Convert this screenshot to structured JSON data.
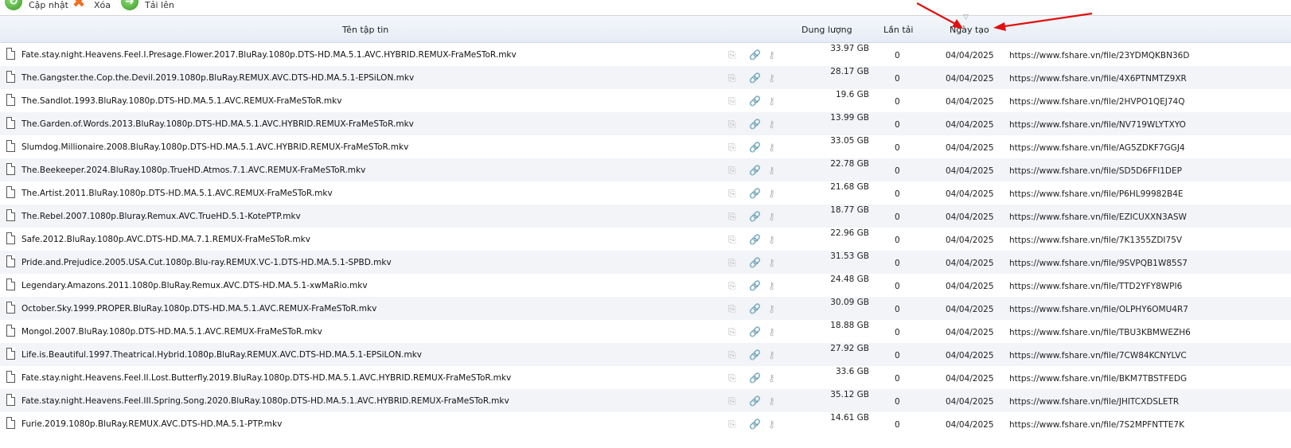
{
  "toolbar": {
    "update_label": "Cập nhật",
    "delete_label": "Xóa",
    "transfer_label": "Tải lên"
  },
  "columns": {
    "name": "Tên tập tin",
    "size": "Dung lượng",
    "downloads": "Lần tải",
    "created": "Ngày tạo"
  },
  "colors": {
    "arrow": "#e01010",
    "header_bg": "#e9eef7",
    "row_alt": "#f2f4f8"
  },
  "files": [
    {
      "name": "Fate.stay.night.Heavens.Feel.I.Presage.Flower.2017.BluRay.1080p.DTS-HD.MA.5.1.AVC.HYBRID.REMUX-FraMeSToR.mkv",
      "size": "33.97 GB",
      "downloads": "0",
      "date": "04/04/2025",
      "link": "https://www.fshare.vn/file/23YDMQKBN36D"
    },
    {
      "name": "The.Gangster.the.Cop.the.Devil.2019.1080p.BluRay.REMUX.AVC.DTS-HD.MA.5.1-EPSiLON.mkv",
      "size": "28.17 GB",
      "downloads": "0",
      "date": "04/04/2025",
      "link": "https://www.fshare.vn/file/4X6PTNMTZ9XR"
    },
    {
      "name": "The.Sandlot.1993.BluRay.1080p.DTS-HD.MA.5.1.AVC.REMUX-FraMeSToR.mkv",
      "size": "19.6 GB",
      "downloads": "0",
      "date": "04/04/2025",
      "link": "https://www.fshare.vn/file/2HVPO1QEJ74Q"
    },
    {
      "name": "The.Garden.of.Words.2013.BluRay.1080p.DTS-HD.MA.5.1.AVC.HYBRID.REMUX-FraMeSToR.mkv",
      "size": "13.99 GB",
      "downloads": "0",
      "date": "04/04/2025",
      "link": "https://www.fshare.vn/file/NV719WLYTXYO"
    },
    {
      "name": "Slumdog.Millionaire.2008.BluRay.1080p.DTS-HD.MA.5.1.AVC.HYBRID.REMUX-FraMeSToR.mkv",
      "size": "33.05 GB",
      "downloads": "0",
      "date": "04/04/2025",
      "link": "https://www.fshare.vn/file/AG5ZDKF7GGJ4"
    },
    {
      "name": "The.Beekeeper.2024.BluRay.1080p.TrueHD.Atmos.7.1.AVC.REMUX-FraMeSToR.mkv",
      "size": "22.78 GB",
      "downloads": "0",
      "date": "04/04/2025",
      "link": "https://www.fshare.vn/file/SD5D6FFI1DEP"
    },
    {
      "name": "The.Artist.2011.BluRay.1080p.DTS-HD.MA.5.1.AVC.REMUX-FraMeSToR.mkv",
      "size": "21.68 GB",
      "downloads": "0",
      "date": "04/04/2025",
      "link": "https://www.fshare.vn/file/P6HL99982B4E"
    },
    {
      "name": "The.Rebel.2007.1080p.Bluray.Remux.AVC.TrueHD.5.1-KotePTP.mkv",
      "size": "18.77 GB",
      "downloads": "0",
      "date": "04/04/2025",
      "link": "https://www.fshare.vn/file/EZICUXXN3ASW"
    },
    {
      "name": "Safe.2012.BluRay.1080p.AVC.DTS-HD.MA.7.1.REMUX-FraMeSToR.mkv",
      "size": "22.96 GB",
      "downloads": "0",
      "date": "04/04/2025",
      "link": "https://www.fshare.vn/file/7K1355ZDI75V"
    },
    {
      "name": "Pride.and.Prejudice.2005.USA.Cut.1080p.Blu-ray.REMUX.VC-1.DTS-HD.MA.5.1-SPBD.mkv",
      "size": "31.53 GB",
      "downloads": "0",
      "date": "04/04/2025",
      "link": "https://www.fshare.vn/file/9SVPQB1W85S7"
    },
    {
      "name": "Legendary.Amazons.2011.1080p.BluRay.Remux.AVC.DTS-HD.MA.5.1-xwMaRio.mkv",
      "size": "24.48 GB",
      "downloads": "0",
      "date": "04/04/2025",
      "link": "https://www.fshare.vn/file/TTD2YFY8WPI6"
    },
    {
      "name": "October.Sky.1999.PROPER.BluRay.1080p.DTS-HD.MA.5.1.AVC.REMUX-FraMeSToR.mkv",
      "size": "30.09 GB",
      "downloads": "0",
      "date": "04/04/2025",
      "link": "https://www.fshare.vn/file/OLPHY6OMU4R7"
    },
    {
      "name": "Mongol.2007.BluRay.1080p.DTS-HD.MA.5.1.AVC.REMUX-FraMeSToR.mkv",
      "size": "18.88 GB",
      "downloads": "0",
      "date": "04/04/2025",
      "link": "https://www.fshare.vn/file/TBU3KBMWEZH6"
    },
    {
      "name": "Life.is.Beautiful.1997.Theatrical.Hybrid.1080p.BluRay.REMUX.AVC.DTS-HD.MA.5.1-EPSiLON.mkv",
      "size": "27.92 GB",
      "downloads": "0",
      "date": "04/04/2025",
      "link": "https://www.fshare.vn/file/7CW84KCNYLVC"
    },
    {
      "name": "Fate.stay.night.Heavens.Feel.II.Lost.Butterfly.2019.BluRay.1080p.DTS-HD.MA.5.1.AVC.HYBRID.REMUX-FraMeSToR.mkv",
      "size": "33.6 GB",
      "downloads": "0",
      "date": "04/04/2025",
      "link": "https://www.fshare.vn/file/BKM7TBSTFEDG"
    },
    {
      "name": "Fate.stay.night.Heavens.Feel.III.Spring.Song.2020.BluRay.1080p.DTS-HD.MA.5.1.AVC.HYBRID.REMUX-FraMeSToR.mkv",
      "size": "35.12 GB",
      "downloads": "0",
      "date": "04/04/2025",
      "link": "https://www.fshare.vn/file/JHITCXDSLETR"
    },
    {
      "name": "Furie.2019.1080p.BluRay.REMUX.AVC.DTS-HD.MA.5.1-PTP.mkv",
      "size": "14.61 GB",
      "downloads": "0",
      "date": "04/04/2025",
      "link": "https://www.fshare.vn/file/7S2MPFNTTE7K"
    }
  ]
}
